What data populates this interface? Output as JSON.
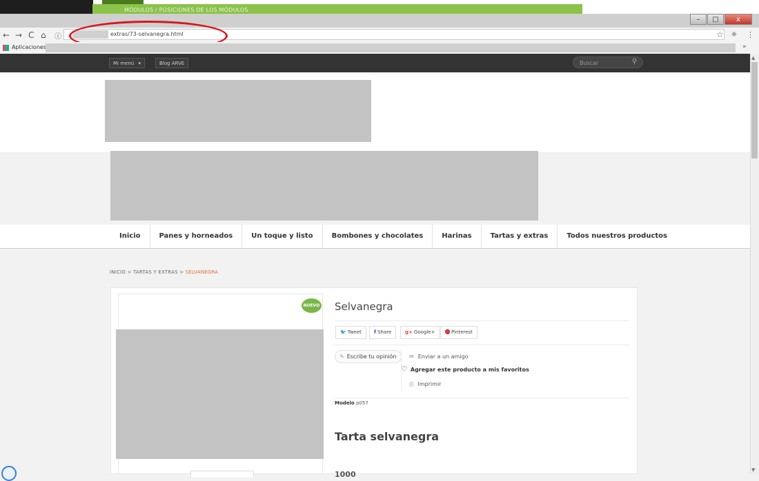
{
  "admin_bar": {
    "crumb_1": "MÓDULOS",
    "sep": "/",
    "crumb_2": "POSICIONES DE LOS MÓDULOS"
  },
  "browser": {
    "window_controls": [
      "–",
      "□",
      "x"
    ],
    "nav": {
      "back": "←",
      "forward": "→",
      "reload": "C",
      "home": "⌂",
      "info": "ⓘ"
    },
    "url": "extras/73-selvanegra.html",
    "star": "☆",
    "menu": "⋮",
    "bookmarks": {
      "apps_label": "Aplicaciones",
      "more": "»"
    }
  },
  "site": {
    "topbar": {
      "my_menu": "Mi menú",
      "blog": "Blog ARVE",
      "search_placeholder": "Buscar",
      "dropdown_arrow": "▾"
    },
    "menu": [
      "Inicio",
      "Panes y horneados",
      "Un toque y listo",
      "Bombones y chocolates",
      "Harinas",
      "Tartas y extras",
      "Todos nuestros productos"
    ],
    "breadcrumb": {
      "home": "INICIO",
      "sep": ">",
      "category": "TARTAS Y EXTRAS",
      "current": "SELVANEGRA"
    }
  },
  "product": {
    "badge": "NUEVO",
    "title": "Selvanegra",
    "social": {
      "tweet": {
        "icon": "🐦",
        "label": "Tweet"
      },
      "share": {
        "icon": "f",
        "label": "Share"
      },
      "google": {
        "icon": "g+",
        "label": "Google+"
      },
      "pinterest": {
        "icon": "⓿",
        "label": "Pinterest"
      }
    },
    "review_label": "Escribe tu opinión",
    "send_friend": "Enviar a un amigo",
    "favorites": "Agregar este producto a mis favoritos",
    "print": "Imprimir",
    "model_label": "Modelo",
    "model_value": "p057",
    "subtitle": "Tarta selvanegra",
    "price_stub": "1000"
  },
  "colors": {
    "accent_green": "#7ab648",
    "admin_green": "#8bc34a",
    "highlight_red": "#d9161c",
    "breadcrumb_current": "#e06a3a"
  }
}
